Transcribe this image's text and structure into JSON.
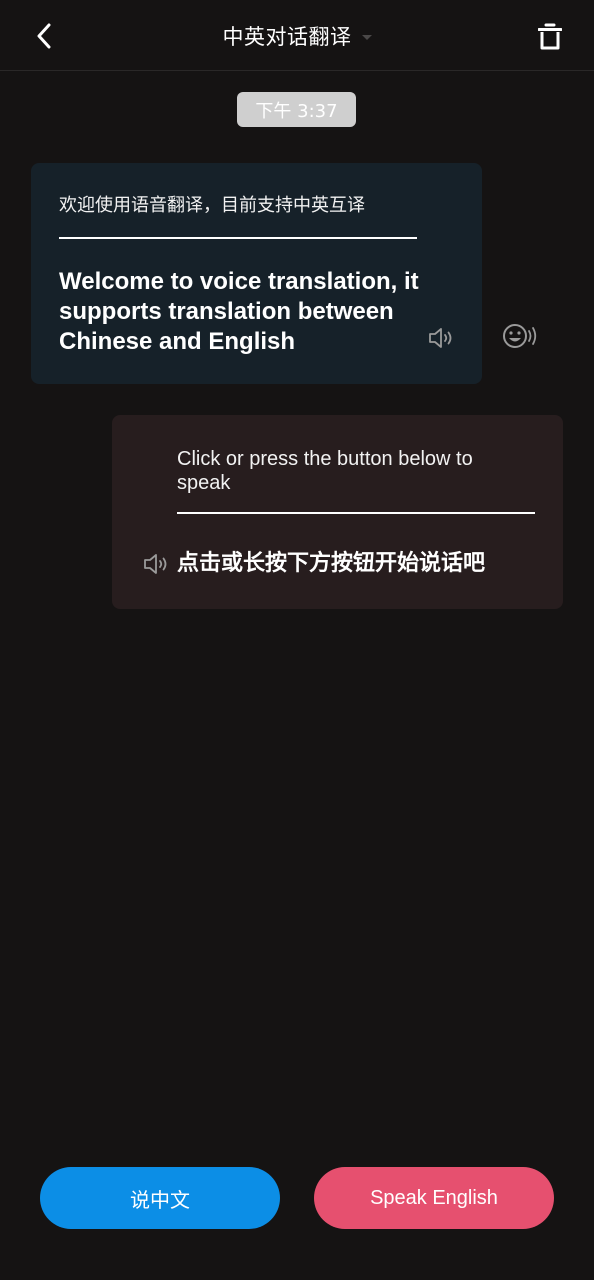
{
  "header": {
    "back_icon": "chevron-left-icon",
    "title": "中英对话翻译",
    "title_dropdown_icon": "caret-down-icon",
    "trash_icon": "trash-icon"
  },
  "timestamp": "下午 3:37",
  "messages": [
    {
      "side": "left",
      "source_text": "欢迎使用语音翻译，目前支持中英互译",
      "translated_text": "Welcome to voice translation, it supports translation between Chinese and English",
      "speaker_icon": "speaker-icon",
      "bubble_color": "#162129"
    },
    {
      "side": "right",
      "source_text": "Click or press the button below to speak",
      "translated_text": "点击或长按下方按钮开始说话吧",
      "speaker_icon": "speaker-icon",
      "bubble_color": "#271d1e"
    }
  ],
  "side_action_icon": "emoji-speak-icon",
  "buttons": {
    "speak_chinese": "说中文",
    "speak_english": "Speak English"
  },
  "colors": {
    "background": "#151313",
    "speak_chinese_button": "#0c8ee6",
    "speak_english_button": "#e6506f",
    "timestamp_pill": "#cfcfcf"
  }
}
